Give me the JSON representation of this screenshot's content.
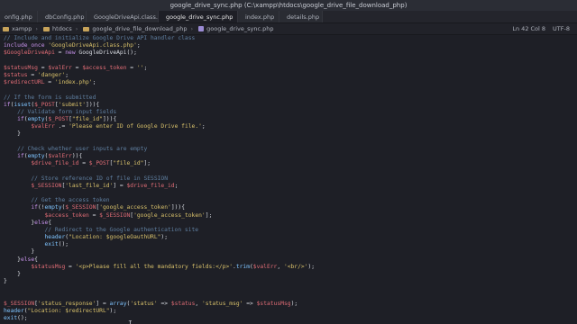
{
  "window": {
    "title": "google_drive_sync.php (C:\\xampp\\htdocs\\google_drive_file_download_php)"
  },
  "tabs": [
    {
      "label": "onfig.php",
      "active": false
    },
    {
      "label": "dbConfig.php",
      "active": false
    },
    {
      "label": "GoogleDriveApi.class.php",
      "active": false
    },
    {
      "label": "google_drive_sync.php",
      "active": true
    },
    {
      "label": "index.php",
      "active": false
    },
    {
      "label": "details.php",
      "active": false
    }
  ],
  "breadcrumb": {
    "items": [
      "xampp",
      "htdocs",
      "google_drive_file_download_php",
      "google_drive_sync.php"
    ]
  },
  "statusbar": {
    "position": "Ln 42 Col 8",
    "encoding": "UTF-8"
  },
  "code_lines": [
    "// Include and initialize Google Drive API handler class",
    "include_once 'GoogleDriveApi.class.php';",
    "$GoogleDriveApi = new GoogleDriveApi();",
    "",
    "$statusMsg = $valErr = $access_token = '';",
    "$status = 'danger';",
    "$redirectURL = 'index.php';",
    "",
    "// If the form is submitted",
    "if(isset($_POST['submit'])){",
    "    // Validate form input fields",
    "    if(empty($_POST[\"file_id\"])){",
    "        $valErr .= 'Please enter ID of Google Drive file.';",
    "    }",
    "",
    "    // Check whether user inputs are empty",
    "    if(empty($valErr)){",
    "        $drive_file_id = $_POST[\"file_id\"];",
    "",
    "        // Store reference ID of file in SESSION",
    "        $_SESSION['last_file_id'] = $drive_file_id;",
    "",
    "        // Get the access token",
    "        if(!empty($_SESSION['google_access_token'])){",
    "            $access_token = $_SESSION['google_access_token'];",
    "        }else{",
    "            // Redirect to the Google authentication site",
    "            header(\"Location: $googleOauthURL\");",
    "            exit();",
    "        }",
    "    }else{",
    "        $statusMsg = '<p>Please fill all the mandatory fields:</p>'.trim($valErr, '<br/>');",
    "    }",
    "}",
    "",
    "",
    "$_SESSION['status_response'] = array('status' => $status, 'status_msg' => $statusMsg);",
    "header(\"Location: $redirectURL\");",
    "exit();"
  ],
  "colors": {
    "background": "#1e1f26",
    "comment": "#5f7fa0",
    "variable": "#e06c75",
    "string": "#d8c06a",
    "keyword": "#c792ea"
  }
}
